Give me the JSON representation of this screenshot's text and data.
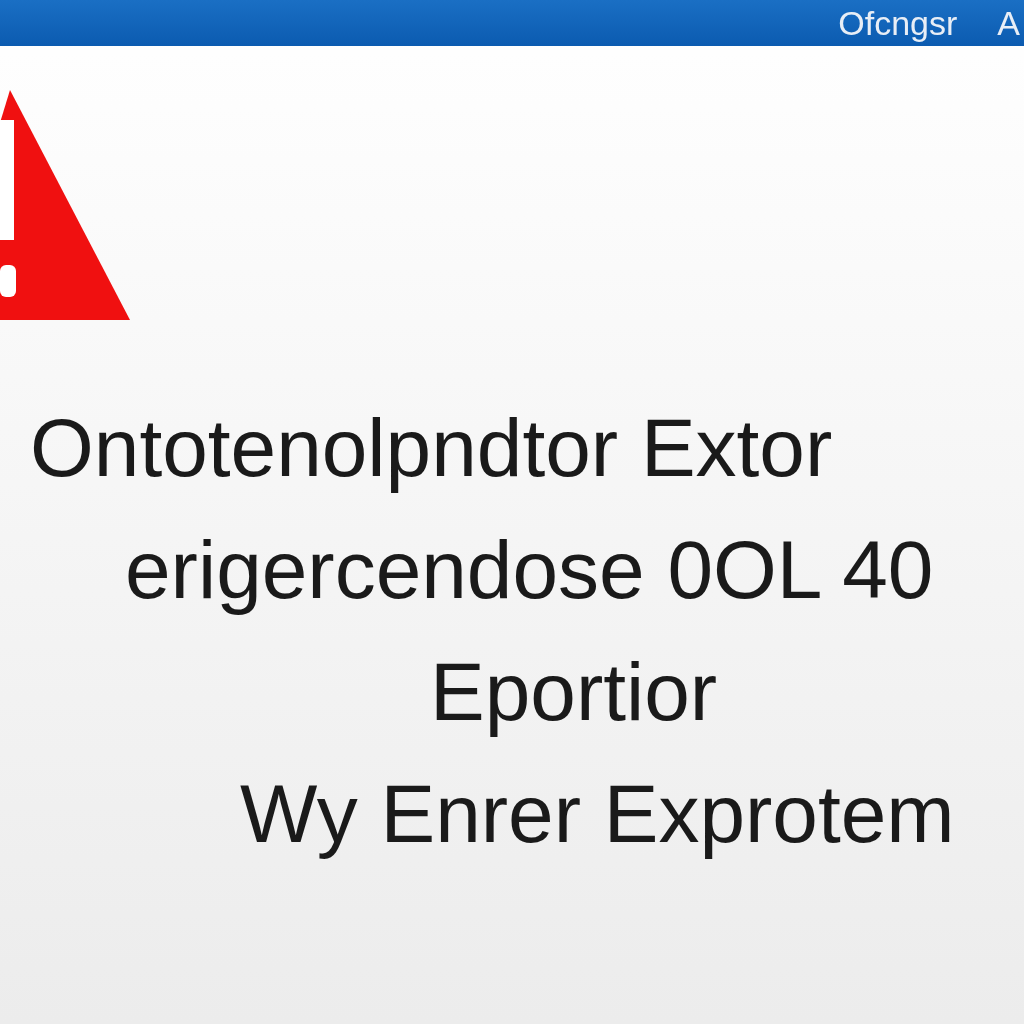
{
  "title_bar": {
    "title": "Ofcngsr",
    "letter": "A"
  },
  "message": {
    "lines": [
      "Ontotenolpndtor Extor",
      "erigercendose 0OL 40",
      "Eportior",
      "Wy Enrer Exprotem"
    ]
  }
}
